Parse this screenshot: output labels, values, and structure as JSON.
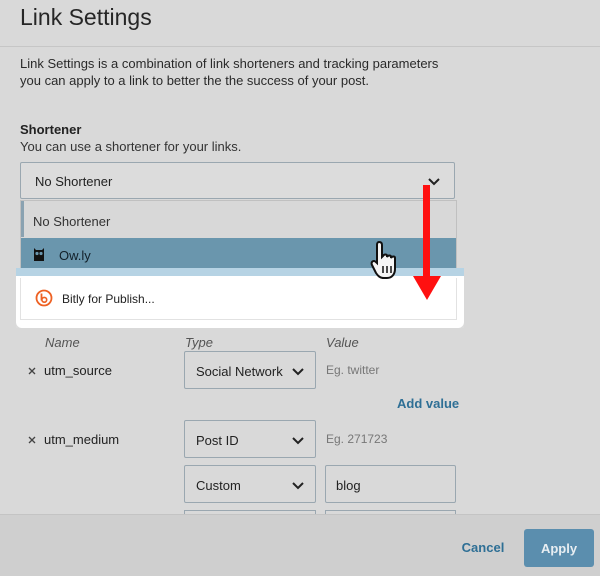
{
  "dialog": {
    "title": "Link Settings",
    "description": "Link Settings is a combination of link shorteners and tracking parameters you can apply to a link to better the the success of your post."
  },
  "shortener": {
    "label": "Shortener",
    "help": "You can use a shortener for your links.",
    "selected": "No Shortener",
    "options": [
      {
        "label": "No Shortener",
        "icon": ""
      },
      {
        "label": "Ow.ly",
        "icon": "owl-icon"
      },
      {
        "label": "Bitly for Publish...",
        "icon": "bitly-icon"
      }
    ]
  },
  "tracking": {
    "columns": [
      "Name",
      "Type",
      "Value"
    ],
    "rows": [
      {
        "name": "utm_source",
        "type": "Social Network",
        "placeholder": "Eg. twitter",
        "value": ""
      },
      {
        "name": "utm_medium",
        "type": "Post ID",
        "placeholder": "Eg. 271723",
        "value": ""
      },
      {
        "name": "",
        "type": "Custom",
        "placeholder": "",
        "value": "blog"
      }
    ],
    "add_value": "Add value"
  },
  "footer": {
    "cancel": "Cancel",
    "apply": "Apply"
  },
  "colors": {
    "accent": "#2e6f95",
    "apply_button": "#5b8eae",
    "selected_option": "#6a96ad",
    "annotation_arrow": "#ff1010",
    "bitly_brand": "#ee6123"
  }
}
